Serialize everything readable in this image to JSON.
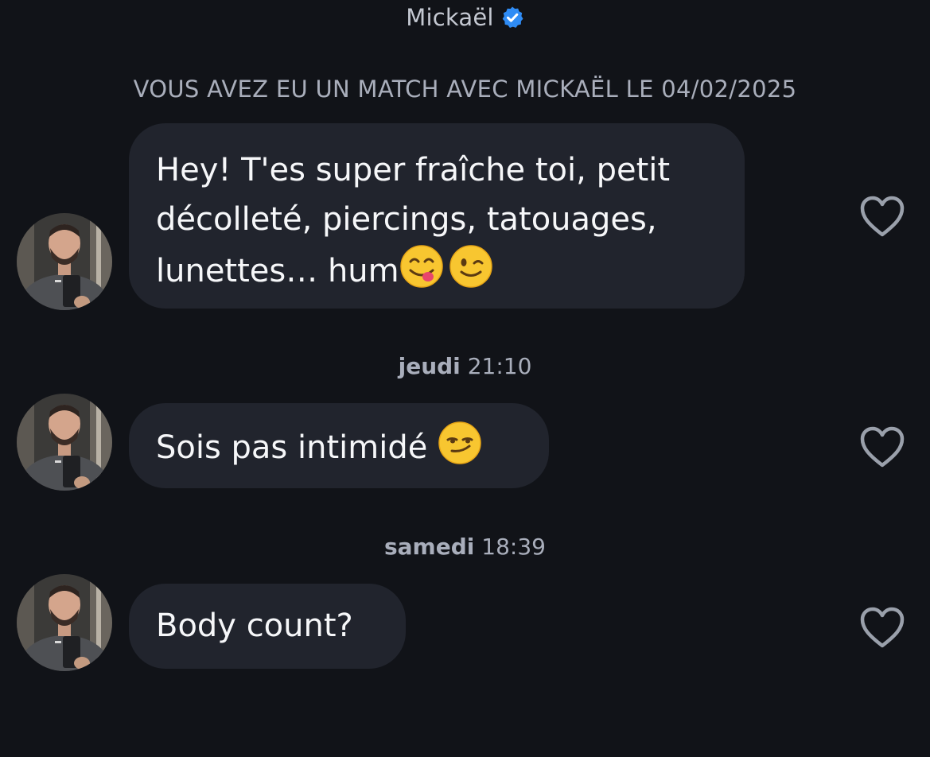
{
  "header": {
    "contact_name": "Mickaël",
    "verified_icon": "verified-badge-icon"
  },
  "match_notice": "VOUS AVEZ EU UN MATCH AVEC MICKAËL LE 04/02/2025",
  "messages": [
    {
      "text": "Hey! T'es super fraîche toi, petit\ndécolleté, piercings, tatouages,\nlunettes… hum",
      "emojis": [
        "yum-face-emoji",
        "winking-face-emoji"
      ],
      "like_icon": "heart-outline-icon"
    },
    {
      "timestamp_day": "jeudi",
      "timestamp_time": "21:10",
      "text": "Sois pas intimidé ",
      "emojis": [
        "smirking-face-emoji"
      ],
      "like_icon": "heart-outline-icon"
    },
    {
      "timestamp_day": "samedi",
      "timestamp_time": "18:39",
      "text": "Body count?",
      "emojis": [],
      "like_icon": "heart-outline-icon"
    }
  ],
  "colors": {
    "background": "#111318",
    "bubble": "#21242d",
    "muted_text": "#a9aebb",
    "verified_blue": "#2f8cf5"
  }
}
